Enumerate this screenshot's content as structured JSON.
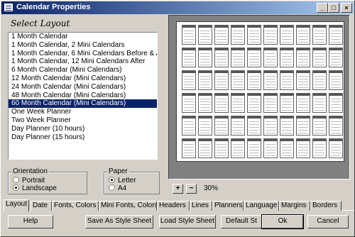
{
  "window": {
    "title": "Calendar Properties"
  },
  "titlebar": {
    "minimize": "_",
    "maximize": "□",
    "close": "×"
  },
  "layout_section": {
    "heading": "Select Layout",
    "items": [
      "1 Month Calendar",
      "1 Month Calendar, 2 Mini Calendars",
      "1 Month Calendar, 6 Mini Calendars Before & Aft",
      "1 Month Calendar, 12 Mini Calendars After",
      "6 Month Calendar (Mini Calendars)",
      "12 Month Calendar (Mini Calendars)",
      "24 Month Calendar (Mini Calendars)",
      "48 Month Calendar (Mini Calendars)",
      "60 Month Calendar (Mini Calendars)",
      "One Week Planner",
      "Two Week Planner",
      "Day Planner (10 hours)",
      "Day Planner (15 hours)"
    ],
    "selected_index": 8
  },
  "orientation": {
    "title": "Orientation",
    "options": [
      "Portrait",
      "Landscape"
    ],
    "selected": "Landscape"
  },
  "paper": {
    "title": "Paper",
    "options": [
      "Letter",
      "A4"
    ],
    "selected": "Letter"
  },
  "preview": {
    "zoom": "30%",
    "zoom_in": "+",
    "zoom_out": "−"
  },
  "tabs": [
    "Layout",
    "Date",
    "Fonts, Colors",
    "Mini Fonts, Colors",
    "Headers",
    "Lines",
    "Planners",
    "Language",
    "Margins",
    "Borders"
  ],
  "active_tab": "Layout",
  "buttons": {
    "help": "Help",
    "save_style": "Save As Style Sheet",
    "load_style": "Load Style Sheet",
    "default": "Default St",
    "ok": "Ok",
    "cancel": "Cancel"
  }
}
